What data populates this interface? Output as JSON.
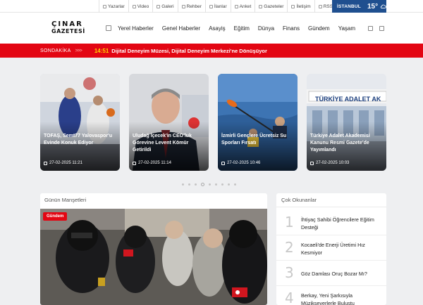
{
  "topbar": {
    "links": [
      {
        "label": "Yazarlar",
        "icon": "pen-icon"
      },
      {
        "label": "Video",
        "icon": "video-icon"
      },
      {
        "label": "Galeri",
        "icon": "gallery-icon"
      },
      {
        "label": "Rehber",
        "icon": "book-icon"
      },
      {
        "label": "İlanlar",
        "icon": "ads-icon"
      },
      {
        "label": "Anket",
        "icon": "poll-icon"
      },
      {
        "label": "Gazeteler",
        "icon": "newspaper-icon"
      },
      {
        "label": "İletişim",
        "icon": "contact-icon"
      },
      {
        "label": "RSS",
        "icon": "rss-icon"
      }
    ],
    "weather": {
      "city": "İSTANBUL",
      "temp": "15°",
      "icon": "cloud-icon"
    }
  },
  "logo": {
    "line1": "ÇINAR",
    "line2": "GAZETESİ"
  },
  "nav": {
    "items": [
      "Yerel Haberler",
      "Genel Haberler",
      "Asayiş",
      "Eğitim",
      "Dünya",
      "Finans",
      "Gündem",
      "Yaşam"
    ]
  },
  "breaking": {
    "label": "SONDAKİKA",
    "time": "14:51",
    "headline": "Dijital Deneyim Müzesi, Dijital Deneyim Merkezi'ne Dönüşüyor"
  },
  "slider": [
    {
      "title": "TOFAŞ, Semt77 Yalovaspor'u Evinde Konuk Ediyor",
      "date": "27-02-2025 11:21"
    },
    {
      "title": "Uludağ İçecek'in CEO'luk Görevine Levent Kömür Getirildi",
      "date": "27-02-2025 11:14"
    },
    {
      "title": "İzmirli Gençlere Ücretsiz Su Sporları Fırsatı",
      "date": "27-02-2025 10:46"
    },
    {
      "title": "Türkiye Adalet Akademisi Kanunu Resmi Gazete'de Yayımlandı",
      "date": "27-02-2025 10:03"
    }
  ],
  "manset": {
    "heading": "Günün Manşetleri",
    "badge": "Gündem"
  },
  "most_read": {
    "heading": "Çok Okunanlar",
    "items": [
      {
        "num": "1",
        "title": "İhtiyaç Sahibi Öğrencilere Eğitim Desteği"
      },
      {
        "num": "2",
        "title": "Kocaeli'de Enerji Üretimi Hız Kesmiyor"
      },
      {
        "num": "3",
        "title": "Göz Damlası Oruç Bozar Mı?"
      },
      {
        "num": "4",
        "title": "Berkay, Yeni Şarkısıyla Müzikseverlerle Buluştu"
      }
    ]
  },
  "colors": {
    "accent": "#e30613",
    "brand_blue": "#1f4f8f",
    "highlight": "#ffd400"
  }
}
